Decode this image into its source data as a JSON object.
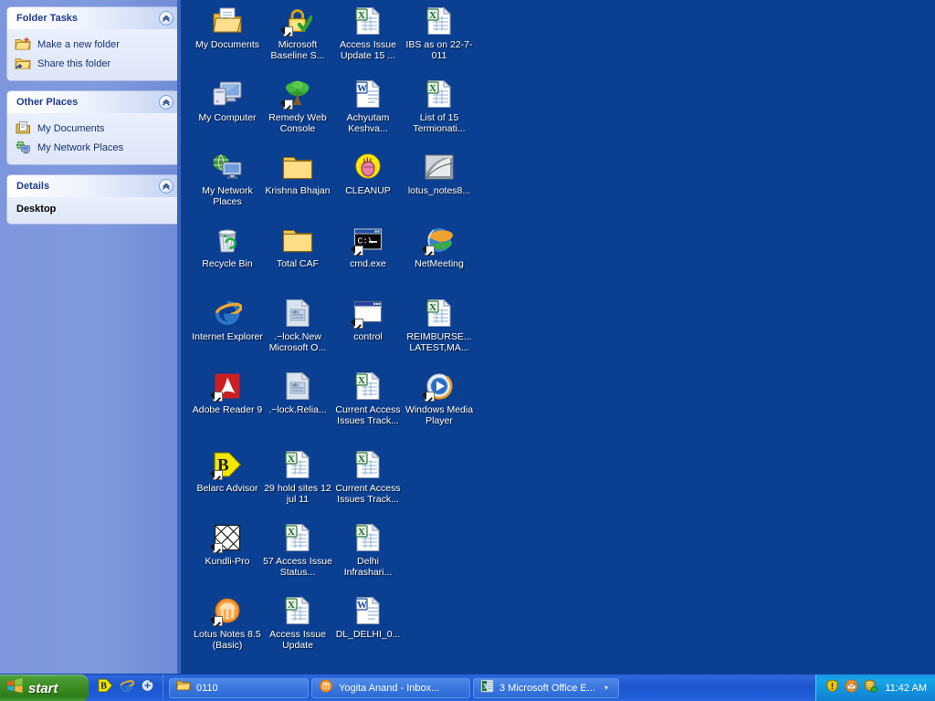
{
  "sidebar": {
    "panels": [
      {
        "title": "Folder Tasks",
        "collapse_icon": "chevron-up-icon",
        "items": [
          {
            "label": "Make a new folder",
            "icon": "new-folder-icon"
          },
          {
            "label": "Share this folder",
            "icon": "share-folder-icon"
          }
        ]
      },
      {
        "title": "Other Places",
        "collapse_icon": "chevron-up-icon",
        "items": [
          {
            "label": "My Documents",
            "icon": "my-documents-icon"
          },
          {
            "label": "My Network Places",
            "icon": "network-places-icon"
          }
        ]
      },
      {
        "title": "Details",
        "collapse_icon": "chevron-up-icon",
        "detail": "Desktop"
      }
    ]
  },
  "desktop": {
    "background_color": "#0a3f91",
    "icons": [
      {
        "label": "My Documents",
        "icon": "my-documents-icon",
        "col": 0,
        "row": 0,
        "shortcut": false
      },
      {
        "label": "Microsoft Baseline S...",
        "icon": "padlock-icon",
        "col": 1,
        "row": 0,
        "shortcut": true
      },
      {
        "label": "Access Issue Update  15 ...",
        "icon": "excel-file-icon",
        "col": 2,
        "row": 0,
        "shortcut": false
      },
      {
        "label": "IBS as on 22-7-011",
        "icon": "excel-file-icon",
        "col": 3,
        "row": 0,
        "shortcut": false
      },
      {
        "label": "My Computer",
        "icon": "my-computer-icon",
        "col": 0,
        "row": 1,
        "shortcut": false
      },
      {
        "label": "Remedy Web Console",
        "icon": "tree-icon",
        "col": 1,
        "row": 1,
        "shortcut": true
      },
      {
        "label": "Achyutam Keshva...",
        "icon": "word-file-icon",
        "col": 2,
        "row": 1,
        "shortcut": false
      },
      {
        "label": "List of 15 Termionati...",
        "icon": "excel-file-icon",
        "col": 3,
        "row": 1,
        "shortcut": false
      },
      {
        "label": "My Network Places",
        "icon": "network-places-icon",
        "col": 0,
        "row": 2,
        "shortcut": false
      },
      {
        "label": "Krishna Bhajan",
        "icon": "folder-icon",
        "col": 1,
        "row": 2,
        "shortcut": false
      },
      {
        "label": "CLEANUP",
        "icon": "cleanup-hand-icon",
        "col": 2,
        "row": 2,
        "shortcut": false
      },
      {
        "label": "lotus_notes8...",
        "icon": "install-image-icon",
        "col": 3,
        "row": 2,
        "shortcut": false
      },
      {
        "label": "Recycle Bin",
        "icon": "recycle-bin-icon",
        "col": 0,
        "row": 3,
        "shortcut": false
      },
      {
        "label": "Total CAF",
        "icon": "folder-icon",
        "col": 1,
        "row": 3,
        "shortcut": false
      },
      {
        "label": "cmd.exe",
        "icon": "command-prompt-icon",
        "col": 2,
        "row": 3,
        "shortcut": true
      },
      {
        "label": "NetMeeting",
        "icon": "netmeeting-icon",
        "col": 3,
        "row": 3,
        "shortcut": true
      },
      {
        "label": "Internet Explorer",
        "icon": "internet-explorer-icon",
        "col": 0,
        "row": 4,
        "shortcut": false
      },
      {
        "label": ".~lock.New Microsoft O...",
        "icon": "generic-doc-icon",
        "col": 1,
        "row": 4,
        "shortcut": false
      },
      {
        "label": "control",
        "icon": "window-icon",
        "col": 2,
        "row": 4,
        "shortcut": true
      },
      {
        "label": "REIMBURSE... LATEST,MA...",
        "icon": "excel-file-icon",
        "col": 3,
        "row": 4,
        "shortcut": false
      },
      {
        "label": "Adobe Reader 9",
        "icon": "adobe-reader-icon",
        "col": 0,
        "row": 5,
        "shortcut": true
      },
      {
        "label": ".~lock.Relia...",
        "icon": "generic-doc-icon",
        "col": 1,
        "row": 5,
        "shortcut": false
      },
      {
        "label": "Current Access Issues Track...",
        "icon": "excel-file-icon",
        "col": 2,
        "row": 5,
        "shortcut": false
      },
      {
        "label": "Windows Media Player",
        "icon": "media-player-icon",
        "col": 3,
        "row": 5,
        "shortcut": true
      },
      {
        "label": "Belarc Advisor",
        "icon": "belarc-icon",
        "col": 0,
        "row": 6,
        "shortcut": true
      },
      {
        "label": "29 hold sites 12 jul 11",
        "icon": "excel-file-icon",
        "col": 1,
        "row": 6,
        "shortcut": false
      },
      {
        "label": "Current Access Issues Track...",
        "icon": "excel-file-icon",
        "col": 2,
        "row": 6,
        "shortcut": false
      },
      {
        "label": "Kundli-Pro",
        "icon": "kundli-grid-icon",
        "col": 0,
        "row": 7,
        "shortcut": true
      },
      {
        "label": "57 Access Issue Status...",
        "icon": "excel-file-icon",
        "col": 1,
        "row": 7,
        "shortcut": false
      },
      {
        "label": "Delhi Infrashari...",
        "icon": "excel-file-icon",
        "col": 2,
        "row": 7,
        "shortcut": false
      },
      {
        "label": "Lotus Notes 8.5 (Basic)",
        "icon": "lotus-notes-icon",
        "col": 0,
        "row": 8,
        "shortcut": true
      },
      {
        "label": "Access Issue Update",
        "icon": "excel-file-icon",
        "col": 1,
        "row": 8,
        "shortcut": false
      },
      {
        "label": "DL_DELHI_0...",
        "icon": "word-file-icon",
        "col": 2,
        "row": 8,
        "shortcut": false
      }
    ]
  },
  "taskbar": {
    "start_label": "start",
    "start_icon": "windows-flag-icon",
    "quick_launch": [
      {
        "icon": "belarc-icon"
      },
      {
        "icon": "internet-explorer-icon"
      },
      {
        "icon": "show-desktop-icon"
      }
    ],
    "buttons": [
      {
        "label": "0110",
        "icon": "folder-icon",
        "caret": ""
      },
      {
        "label": "Yogita Anand - Inbox...",
        "icon": "lotus-notes-icon",
        "caret": ""
      },
      {
        "label": "3 Microsoft Office E...",
        "icon": "excel-file-icon",
        "caret": "▾"
      }
    ],
    "tray": {
      "icons": [
        {
          "icon": "security-shield-icon"
        },
        {
          "icon": "mail-envelope-icon"
        },
        {
          "icon": "network-shield-icon"
        }
      ],
      "clock": "11:42 AM"
    }
  }
}
